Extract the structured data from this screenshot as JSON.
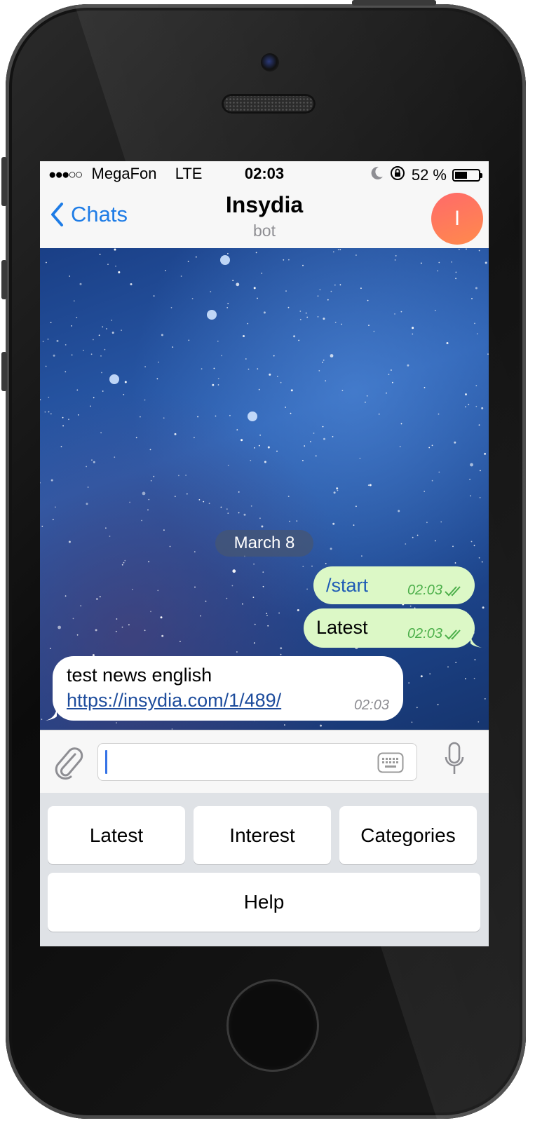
{
  "status_bar": {
    "signal_dots": "●●●○○",
    "carrier": "MegaFon",
    "network": "LTE",
    "time": "02:03",
    "battery_text": "52 %",
    "battery_level": 0.52,
    "icons": [
      "moon-icon",
      "rotation-lock-icon",
      "battery-icon"
    ]
  },
  "navbar": {
    "back_label": "Chats",
    "title": "Insydia",
    "subtitle": "bot",
    "avatar_letter": "I",
    "avatar_colors": [
      "#ff6a6a",
      "#ff8a4c"
    ]
  },
  "chat": {
    "date": "March 8",
    "messages": [
      {
        "direction": "outgoing",
        "text": "/start",
        "time": "02:03",
        "status": "read"
      },
      {
        "direction": "outgoing",
        "text": "Latest",
        "time": "02:03",
        "status": "read"
      },
      {
        "direction": "incoming",
        "text": "test news english",
        "link": "https://insydia.com/1/489/",
        "time": "02:03"
      }
    ]
  },
  "input": {
    "placeholder": "",
    "value": ""
  },
  "reply_keyboard": {
    "rows": [
      [
        "Latest",
        "Interest",
        "Categories"
      ],
      [
        "Help"
      ]
    ]
  },
  "colors": {
    "accent": "#1e7ce6",
    "outgoing_bubble": "#dcf8c6",
    "read_check": "#4caf4a"
  }
}
